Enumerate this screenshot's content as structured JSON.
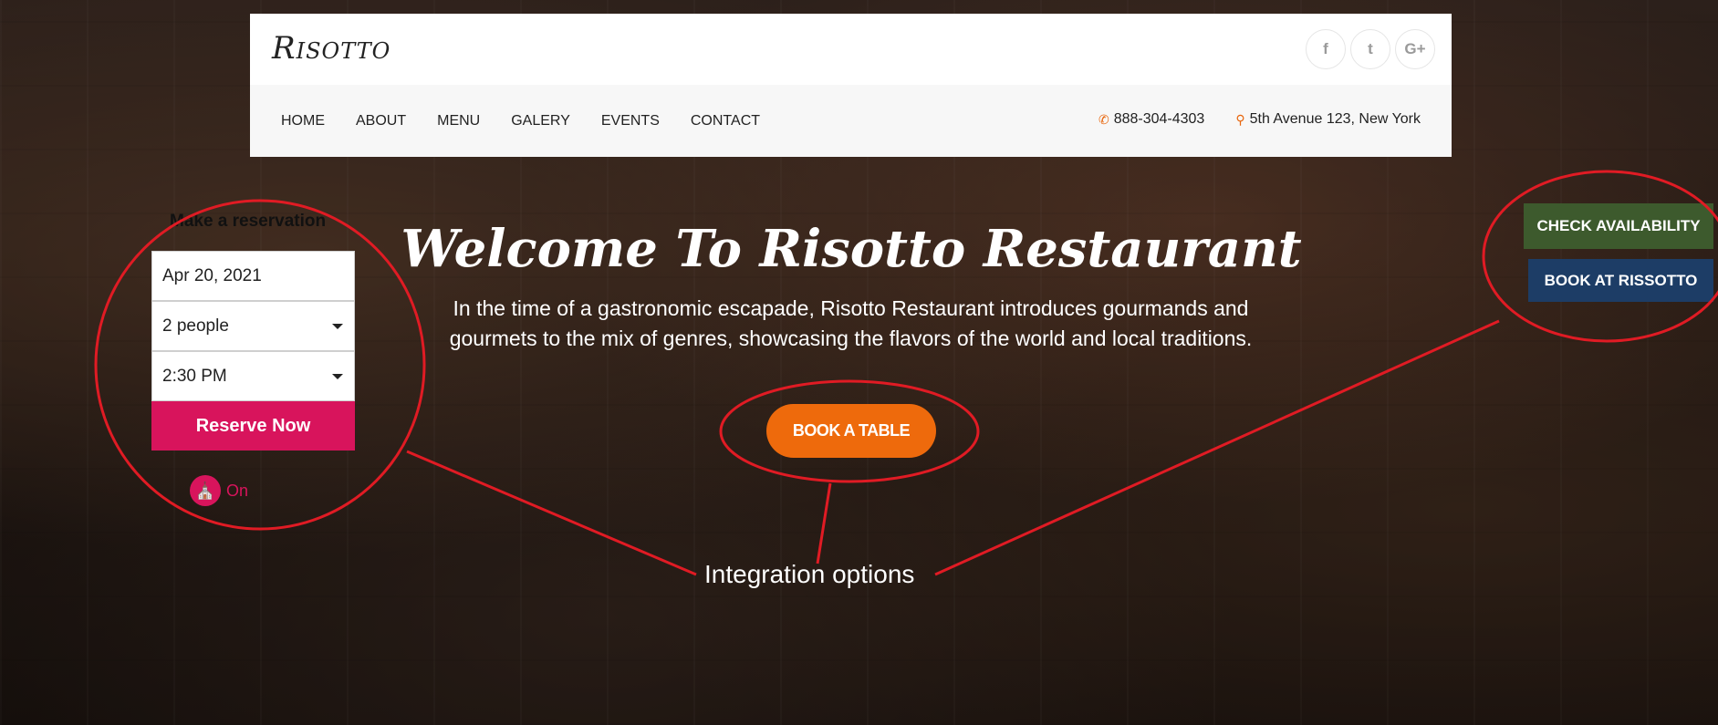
{
  "header": {
    "logo": "Risotto",
    "social": [
      {
        "icon": "facebook-icon",
        "glyph": "f"
      },
      {
        "icon": "twitter-icon",
        "glyph": "t"
      },
      {
        "icon": "google-plus-icon",
        "glyph": "G+"
      }
    ],
    "nav": [
      "HOME",
      "ABOUT",
      "MENU",
      "GALERY",
      "EVENTS",
      "CONTACT"
    ],
    "phone": "888-304-4303",
    "address": "5th Avenue 123, New York"
  },
  "reservation": {
    "title": "Make a reservation",
    "date": "Apr 20, 2021",
    "party": "2 people",
    "time": "2:30 PM",
    "button": "Reserve Now",
    "brand_text": "On"
  },
  "hero": {
    "welcome": "Welcome To Risotto Restaurant",
    "intro": "In the time of a gastronomic escapade, Risotto Restaurant introduces gourmands and gourmets to the mix of genres, showcasing the flavors of the world and local traditions.",
    "book_button": "BOOK A TABLE"
  },
  "side_buttons": {
    "check": "CHECK AVAILABILITY",
    "book": "BOOK AT RISSOTTO"
  },
  "annotation": {
    "label": "Integration options",
    "color": "#e01b24"
  },
  "colors": {
    "accent_orange": "#ee6a0c",
    "opentable_pink": "#d8145c",
    "check_green": "#3d5a2d",
    "book_blue": "#1d3d66"
  }
}
